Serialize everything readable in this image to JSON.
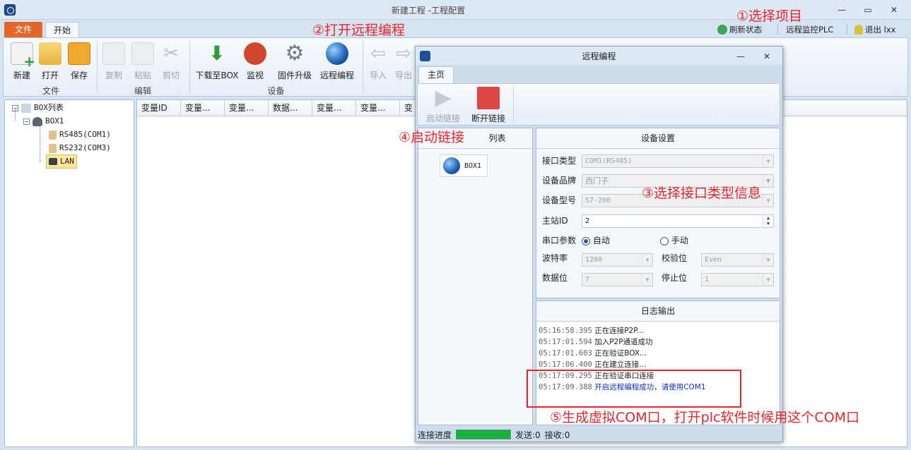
{
  "window": {
    "title": "新建工程 -工程配置",
    "tabs": {
      "file": "文件",
      "start": "开始"
    },
    "actions": {
      "refresh": "刷新状态",
      "remote_monitor": "远程监控PLC",
      "logout": "退出 lxx"
    }
  },
  "ribbon": {
    "file_group": {
      "label": "文件",
      "new": "新建",
      "open": "打开",
      "save": "保存"
    },
    "edit_group": {
      "label": "编辑",
      "copy": "复制",
      "paste": "粘贴",
      "cut": "剪切"
    },
    "device_group": {
      "label": "设备",
      "download": "下载至BOX",
      "monitor": "监视",
      "firmware": "固件升级",
      "remote": "远程编程"
    },
    "import": "导入",
    "export": "导出"
  },
  "tree": {
    "root": "BOX列表",
    "box": "BOX1",
    "items": [
      "RS485(COM1)",
      "RS232(COM3)",
      "LAN"
    ]
  },
  "table": {
    "columns": [
      "变量ID",
      "变量...",
      "变量...",
      "数据...",
      "变量...",
      "变量...",
      "变"
    ]
  },
  "dialog": {
    "title": "远程编程",
    "tab": "主页",
    "start_link": "启动链接",
    "stop_link": "断开链接",
    "box_list_title": "列表",
    "box_item": "BOX1",
    "device_settings": {
      "title": "设备设置",
      "interface_label": "接口类型",
      "interface_value": "COM1(RS485)",
      "brand_label": "设备品牌",
      "brand_value": "西门子",
      "model_label": "设备型号",
      "model_value": "S7-200",
      "station_label": "主站ID",
      "station_value": "2",
      "serial_label": "串口参数",
      "auto": "自动",
      "manual": "手动",
      "baud_label": "波特率",
      "baud_value": "1200",
      "parity_label": "校验位",
      "parity_value": "Even",
      "databits_label": "数据位",
      "databits_value": "7",
      "stopbits_label": "停止位",
      "stopbits_value": "1"
    },
    "log": {
      "title": "日志输出",
      "lines": [
        {
          "time": "05:16:58.395",
          "text": "正在连接P2P..."
        },
        {
          "time": "05:17:01.594",
          "text": "加入P2P通道成功"
        },
        {
          "time": "05:17:01.603",
          "text": "正在验证BOX..."
        },
        {
          "time": "05:17:06.400",
          "text": "正在建立连接..."
        },
        {
          "time": "05:17:09.295",
          "text": "正在验证串口连接"
        },
        {
          "time": "05:17:09.388",
          "text": "开启远程编程成功，请使用COM1"
        }
      ]
    },
    "status": {
      "progress_label": "连接进度",
      "progress": 1.0,
      "sent": "发送:0",
      "received": "接收:0"
    }
  },
  "annotations": {
    "a1": "①选择项目",
    "a2": "②打开远程编程",
    "a3": "③选择接口类型信息",
    "a4": "④启动链接",
    "a5": "⑤生成虚拟COM口，打开plc软件时候用这个COM口"
  }
}
